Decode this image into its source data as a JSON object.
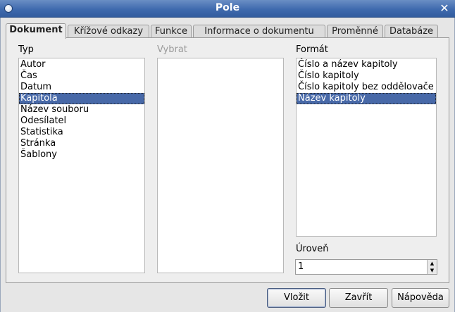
{
  "window": {
    "title": "Pole"
  },
  "tabs": [
    {
      "label": "Dokument",
      "active": true
    },
    {
      "label": "Křížové odkazy"
    },
    {
      "label": "Funkce"
    },
    {
      "label": "Informace o dokumentu"
    },
    {
      "label": "Proměnné"
    },
    {
      "label": "Databáze"
    }
  ],
  "typ": {
    "label": "Typ",
    "items": [
      "Autor",
      "Čas",
      "Datum",
      "Kapitola",
      "Název souboru",
      "Odesílatel",
      "Statistika",
      "Stránka",
      "Šablony"
    ],
    "selected": "Kapitola"
  },
  "vybrat": {
    "label": "Vybrat",
    "items": []
  },
  "format": {
    "label": "Formát",
    "items": [
      "Číslo a název kapitoly",
      "Číslo kapitoly",
      "Číslo kapitoly bez oddělovače",
      "Název kapitoly"
    ],
    "selected": "Název kapitoly"
  },
  "uroven": {
    "label": "Úroveň",
    "value": "1"
  },
  "buttons": {
    "insert": "Vložit",
    "close": "Zavřít",
    "help": "Nápověda"
  },
  "colors": {
    "titlebar": "#3f6aae",
    "selection": "#4869a8"
  }
}
